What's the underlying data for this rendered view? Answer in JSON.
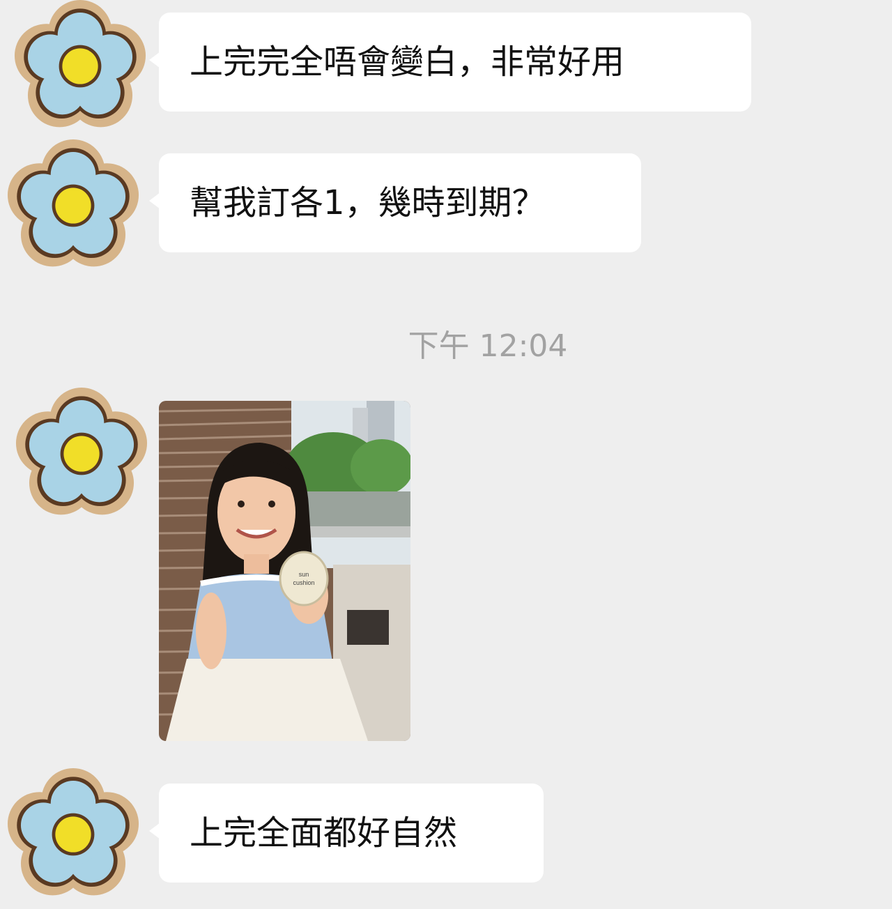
{
  "messages": [
    {
      "text": "上完完全唔會變白，非常好用"
    },
    {
      "text": "幫我訂各1，幾時到期？"
    },
    {
      "timestamp": "下午 12:04"
    },
    {
      "image": "photo-girl-holding-cushion-compact"
    },
    {
      "text": "上完全面都好自然"
    }
  ],
  "avatar": {
    "icon": "flower-avatar-icon",
    "petal_color": "#a9d3e6",
    "center_color": "#f1de28"
  }
}
